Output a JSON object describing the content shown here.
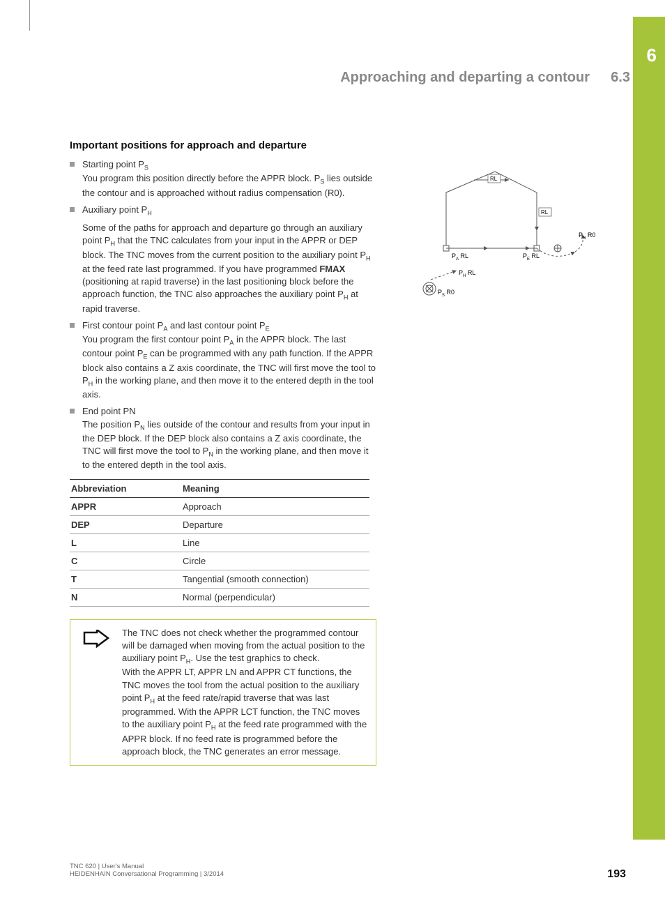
{
  "header": {
    "title": "Approaching and departing a contour",
    "section": "6.3",
    "chapter": "6"
  },
  "heading": "Important positions for approach and departure",
  "bullets": [
    {
      "title_pre": "Starting point P",
      "title_sub": "S",
      "p1_pre": "You program this position directly before the APPR block. P",
      "p1_sub": "S",
      "p1_post": " lies outside the contour and is approached without radius compensation (R0)."
    },
    {
      "title_pre": "Auxiliary point P",
      "title_sub": "H",
      "p1_pre": "Some of the paths for approach and departure go through an auxiliary point P",
      "p1_sub": "H",
      "p1_post": " that the TNC calculates from your input in the APPR or DEP block. The TNC moves from the current position to the auxiliary point P",
      "p1_sub2": "H",
      "p1_post2": " at the feed rate last programmed. If you have programmed ",
      "bold": "FMAX",
      "p1_post3": " (positioning at rapid traverse) in the last positioning block before the approach function, the TNC also approaches the auxiliary point P",
      "p1_sub3": "H",
      "p1_post4": " at rapid traverse."
    },
    {
      "title_pre": "First contour point P",
      "title_sub": "A",
      "title_mid": " and last contour point P",
      "title_sub2": "E",
      "p1_pre": "You program the first contour point P",
      "p1_sub": "A",
      "p1_post": " in the APPR block. The last contour point P",
      "p1_sub2": "E",
      "p1_post2": " can be programmed with any path function. If the APPR block also contains a Z axis coordinate, the TNC will first move the tool to P",
      "p1_sub3": "H",
      "p1_post3": " in the working plane, and then move it to the entered depth in the tool axis."
    },
    {
      "title_pre": "End point PN",
      "p1_pre": "The position P",
      "p1_sub": "N",
      "p1_post": " lies outside of the contour and results from your input in the DEP block. If the DEP block also contains a Z axis coordinate, the TNC will first move the tool to P",
      "p1_sub2": "N",
      "p1_post2": " in the working plane, and then move it to the entered depth in the tool axis."
    }
  ],
  "table": {
    "head_abbrev": "Abbreviation",
    "head_meaning": "Meaning",
    "rows": [
      {
        "abbrev": "APPR",
        "meaning": "Approach"
      },
      {
        "abbrev": "DEP",
        "meaning": "Departure"
      },
      {
        "abbrev": "L",
        "meaning": "Line"
      },
      {
        "abbrev": "C",
        "meaning": "Circle"
      },
      {
        "abbrev": "T",
        "meaning": "Tangential (smooth connection)"
      },
      {
        "abbrev": "N",
        "meaning": "Normal (perpendicular)"
      }
    ]
  },
  "note": {
    "p1_pre": "The TNC does not check whether the programmed contour will be damaged when moving from the actual position to the auxiliary point P",
    "p1_sub": "H",
    "p1_post": ". Use the test graphics to check.",
    "p2_pre": "With the APPR LT, APPR LN and APPR CT functions, the TNC moves the tool from the actual position to the auxiliary point P",
    "p2_sub": "H",
    "p2_post": " at the feed rate/rapid traverse that was last programmed. With the APPR LCT function, the TNC moves to the auxiliary point P",
    "p2_sub2": "H",
    "p2_post2": " at the feed rate programmed with the APPR block. If no feed rate is programmed before the approach block, the TNC generates an error message."
  },
  "figure": {
    "labels": {
      "rl_top": "RL",
      "rl_right": "RL",
      "pa_rl": "P  RL",
      "pa_sub": "A",
      "pe_rl": "P  RL",
      "pe_sub": "E",
      "pn_r0": "P  R0",
      "pn_sub": "N",
      "ph_rl": "P  RL",
      "ph_sub": "H",
      "ps_r0": "P  R0",
      "ps_sub": "S"
    }
  },
  "footer": {
    "line1": "TNC 620 | User's Manual",
    "line2": "HEIDENHAIN Conversational Programming | 3/2014",
    "page": "193"
  }
}
